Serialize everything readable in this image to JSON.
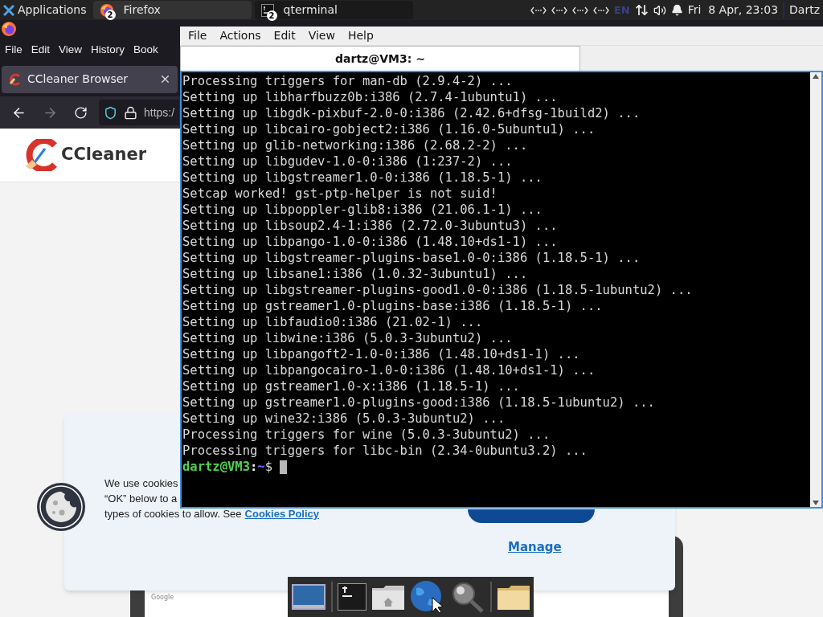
{
  "top_panel": {
    "applications": "Applications",
    "tasks": [
      {
        "kind": "browser",
        "label": "Firefox",
        "count": "2",
        "selected": false
      },
      {
        "kind": "terminal",
        "label": "qterminal",
        "count": "2",
        "selected": true
      }
    ],
    "keyboard_layout": "EN",
    "clock": "Fri  8 Apr, 23:03",
    "user": "Dartz"
  },
  "firefox": {
    "menu": [
      "File",
      "Edit",
      "View",
      "History",
      "Book"
    ],
    "tabs": [
      {
        "title": "CCleaner Browser",
        "selected": true
      }
    ],
    "url": "https:/",
    "page": {
      "logo_text": "CCleaner",
      "cookie_banner": {
        "lines": [
          "We use cookies",
          "“OK” below to a",
          "types of cookies to allow. See"
        ],
        "policy_link": "Cookies Policy",
        "manage_link": "Manage"
      },
      "card_label": "Google"
    }
  },
  "terminal": {
    "menu": [
      "File",
      "Actions",
      "Edit",
      "View",
      "Help"
    ],
    "tabs": [
      {
        "title": "dartz@VM3: ~",
        "selected": true
      }
    ],
    "lines": [
      "Processing triggers for man-db (2.9.4-2) ...",
      "Setting up libharfbuzz0b:i386 (2.7.4-1ubuntu1) ...",
      "Setting up libgdk-pixbuf-2.0-0:i386 (2.42.6+dfsg-1build2) ...",
      "Setting up libcairo-gobject2:i386 (1.16.0-5ubuntu1) ...",
      "Setting up glib-networking:i386 (2.68.2-2) ...",
      "Setting up libgudev-1.0-0:i386 (1:237-2) ...",
      "Setting up libgstreamer1.0-0:i386 (1.18.5-1) ...",
      "Setcap worked! gst-ptp-helper is not suid!",
      "Setting up libpoppler-glib8:i386 (21.06.1-1) ...",
      "Setting up libsoup2.4-1:i386 (2.72.0-3ubuntu3) ...",
      "Setting up libpango-1.0-0:i386 (1.48.10+ds1-1) ...",
      "Setting up libgstreamer-plugins-base1.0-0:i386 (1.18.5-1) ...",
      "Setting up libsane1:i386 (1.0.32-3ubuntu1) ...",
      "Setting up libgstreamer-plugins-good1.0-0:i386 (1.18.5-1ubuntu2) ...",
      "Setting up gstreamer1.0-plugins-base:i386 (1.18.5-1) ...",
      "Setting up libfaudio0:i386 (21.02-1) ...",
      "Setting up libwine:i386 (5.0.3-3ubuntu2) ...",
      "Setting up libpangoft2-1.0-0:i386 (1.48.10+ds1-1) ...",
      "Setting up libpangocairo-1.0-0:i386 (1.48.10+ds1-1) ...",
      "Setting up gstreamer1.0-x:i386 (1.18.5-1) ...",
      "Setting up gstreamer1.0-plugins-good:i386 (1.18.5-1ubuntu2) ...",
      "Setting up wine32:i386 (5.0.3-3ubuntu2) ...",
      "Processing triggers for wine (5.0.3-3ubuntu2) ...",
      "Processing triggers for libc-bin (2.34-0ubuntu3.2) ..."
    ],
    "prompt": {
      "user_host": "dartz@VM3",
      "separator": ":",
      "path": "~",
      "symbol": "$"
    }
  },
  "dock": [
    {
      "kind": "screen"
    },
    {
      "kind": "terminal"
    },
    {
      "kind": "home"
    },
    {
      "kind": "globe"
    },
    {
      "kind": "search"
    },
    {
      "kind": "folder"
    }
  ]
}
